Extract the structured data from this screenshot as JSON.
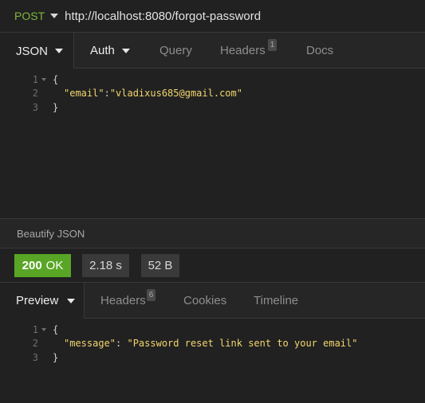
{
  "request": {
    "method": "POST",
    "url": "http://localhost:8080/forgot-password"
  },
  "request_tabs": {
    "body": "JSON",
    "auth": "Auth",
    "query": "Query",
    "headers": "Headers",
    "headers_count": "1",
    "docs": "Docs"
  },
  "request_body": {
    "line_numbers": [
      "1",
      "2",
      "3"
    ],
    "open_brace": "{",
    "key": "\"email\"",
    "colon": ":",
    "value": "\"vladixus685@gmail.com\"",
    "close_brace": "}"
  },
  "beautify_label": "Beautify JSON",
  "response_status": {
    "code": "200",
    "text": "OK",
    "time": "2.18 s",
    "size": "52 B",
    "colors": {
      "ok": "#59a626",
      "method": "#7fb83c",
      "json_string": "#f2d66e"
    }
  },
  "response_tabs": {
    "preview": "Preview",
    "headers": "Headers",
    "headers_count": "6",
    "cookies": "Cookies",
    "timeline": "Timeline"
  },
  "response_body": {
    "line_numbers": [
      "1",
      "2",
      "3"
    ],
    "open_brace": "{",
    "key": "\"message\"",
    "colon": ": ",
    "value": "\"Password reset link sent to your email\"",
    "close_brace": "}"
  }
}
